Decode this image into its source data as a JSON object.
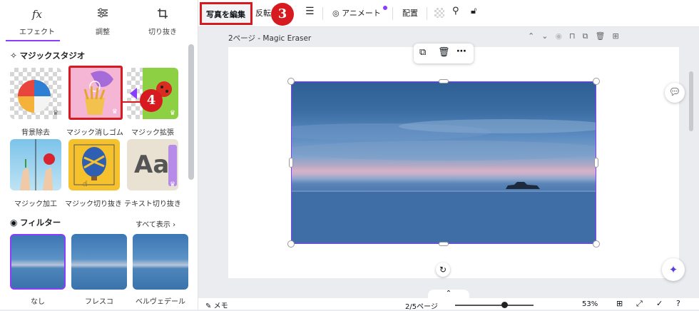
{
  "left_panel": {
    "tabs": [
      {
        "label": "エフェクト",
        "icon": "fx"
      },
      {
        "label": "調整",
        "icon": "sliders-icon"
      },
      {
        "label": "切り抜き",
        "icon": "crop-icon"
      }
    ],
    "magic_studio_title": "マジックスタジオ",
    "tools": [
      {
        "label": "背景除去"
      },
      {
        "label": "マジック消しゴム"
      },
      {
        "label": "マジック拡張"
      },
      {
        "label": "マジック加工"
      },
      {
        "label": "マジック切り抜き"
      },
      {
        "label": "テキスト切り抜き"
      }
    ],
    "filters_title": "フィルター",
    "see_all": "すべて表示",
    "filters": [
      {
        "label": "なし"
      },
      {
        "label": "フレスコ"
      },
      {
        "label": "ベルヴェデール"
      }
    ]
  },
  "toolbar": {
    "edit_photo": "写真を編集",
    "flip": "反転",
    "animate": "アニメート",
    "position": "配置"
  },
  "callouts": {
    "step3": "3",
    "step4": "4"
  },
  "page": {
    "title": "2ページ - Magic Eraser"
  },
  "tile_text": {
    "aa": "Aa"
  },
  "bottom": {
    "notes": "メモ",
    "page_count": "2/5ページ",
    "zoom": "53%"
  },
  "colors": {
    "accent": "#8b3dff",
    "callout": "#d71920"
  }
}
